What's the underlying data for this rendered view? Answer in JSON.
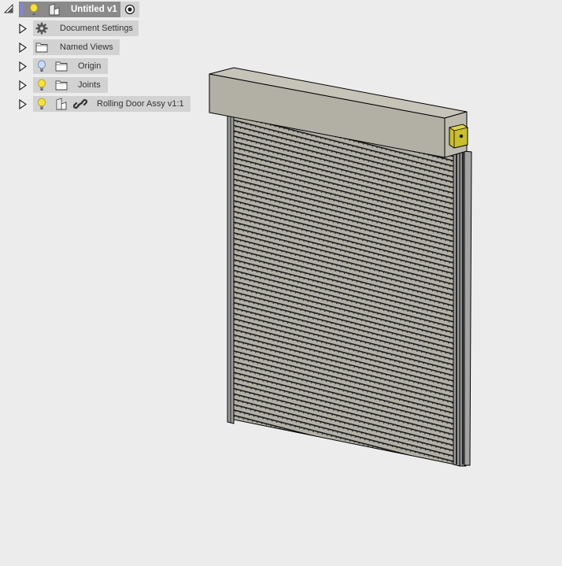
{
  "browser": {
    "root": {
      "label": "Untitled v1",
      "expanded": true,
      "icons": [
        "lightbulb-on-icon",
        "component-icon",
        "activate-radio-icon"
      ]
    },
    "items": [
      {
        "label": "Document Settings",
        "icons": [
          "gear-icon"
        ],
        "expanded": false
      },
      {
        "label": "Named Views",
        "icons": [
          "folder-icon"
        ],
        "expanded": false
      },
      {
        "label": "Origin",
        "icons": [
          "lightbulb-off-icon",
          "folder-icon"
        ],
        "expanded": false
      },
      {
        "label": "Joints",
        "icons": [
          "lightbulb-on-icon",
          "folder-icon"
        ],
        "expanded": false
      },
      {
        "label": "Rolling Door Assy v1:1",
        "icons": [
          "lightbulb-on-icon",
          "component-icon",
          "link-icon"
        ],
        "expanded": false
      }
    ]
  },
  "viewport": {
    "model_name": "Rolling Door Assy",
    "colors": {
      "background": "#ececec",
      "housing": "#b4b1a6",
      "housing_top": "#c6c3b8",
      "slats": "#b0ada3",
      "rails": "#9a9a9a",
      "bracket": "#c9bf2e",
      "edges": "#000000"
    }
  }
}
